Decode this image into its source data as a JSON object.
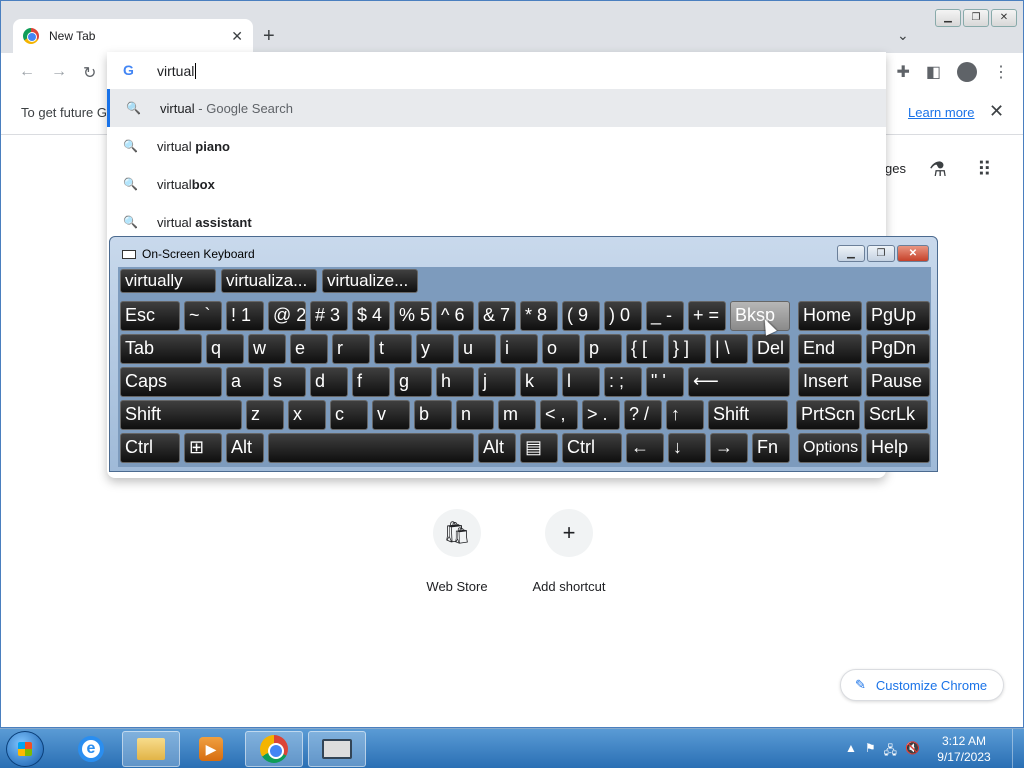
{
  "browser": {
    "tab_title": "New Tab",
    "new_tab": "+",
    "infobar_message": "To get future G",
    "learn_more": "Learn more",
    "images_fragment": "ges"
  },
  "omnibox": {
    "value": "virtual",
    "suggestions": [
      {
        "prefix": "virtual",
        "bold": "",
        "suffix": " - Google Search"
      },
      {
        "prefix": "virtual ",
        "bold": "piano",
        "suffix": ""
      },
      {
        "prefix": "virtual",
        "bold": "box",
        "suffix": ""
      },
      {
        "prefix": "virtual ",
        "bold": "assistant",
        "suffix": ""
      }
    ]
  },
  "shortcuts": [
    {
      "label": "Web Store"
    },
    {
      "label": "Add shortcut"
    }
  ],
  "customize_label": "Customize Chrome",
  "osk": {
    "title": "On-Screen Keyboard",
    "predictions": [
      "virtually",
      "virtualiza...",
      "virtualize..."
    ],
    "rows": [
      [
        "Esc",
        "~ `",
        "! 1",
        "@ 2",
        "# 3",
        "$ 4",
        "% 5",
        "^ 6",
        "& 7",
        "* 8",
        "( 9",
        ") 0",
        "_ -",
        "+ =",
        "Bksp",
        "Home",
        "PgUp"
      ],
      [
        "Tab",
        "q",
        "w",
        "e",
        "r",
        "t",
        "y",
        "u",
        "i",
        "o",
        "p",
        "{ [",
        "} ]",
        "| \\",
        "Del",
        "End",
        "PgDn"
      ],
      [
        "Caps",
        "a",
        "s",
        "d",
        "f",
        "g",
        "h",
        "j",
        "k",
        "l",
        ": ;",
        "\" '",
        "⟵",
        "Insert",
        "Pause"
      ],
      [
        "Shift",
        "z",
        "x",
        "c",
        "v",
        "b",
        "n",
        "m",
        "< ,",
        "> .",
        "? /",
        "↑",
        "Shift",
        "PrtScn",
        "ScrLk"
      ],
      [
        "Ctrl",
        "⊞",
        "Alt",
        "",
        "Alt",
        "▤",
        "Ctrl",
        "←",
        "↓",
        "→",
        "Fn",
        "Options",
        "Help"
      ]
    ]
  },
  "taskbar": {
    "time": "3:12 AM",
    "date": "9/17/2023"
  }
}
